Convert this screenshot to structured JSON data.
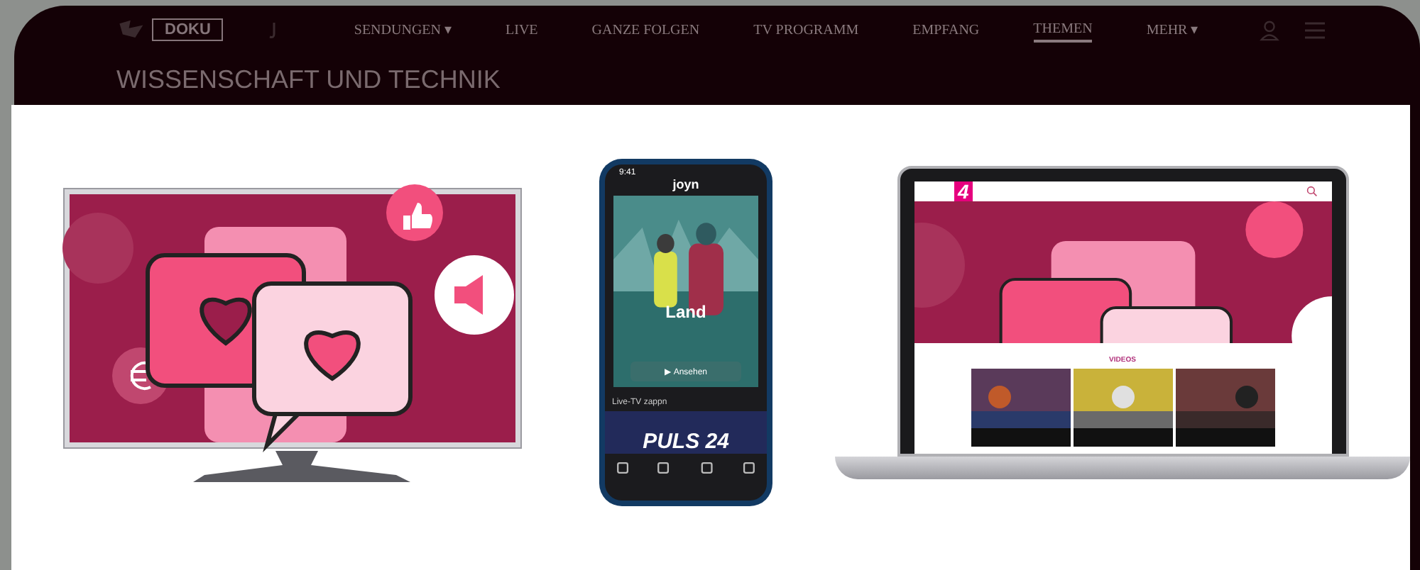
{
  "header": {
    "logo": "DOKU",
    "nav": [
      {
        "label": "SENDUNGEN ▾",
        "selected": false
      },
      {
        "label": "LIVE",
        "selected": false
      },
      {
        "label": "GANZE FOLGEN",
        "selected": false
      },
      {
        "label": "TV PROGRAMM",
        "selected": false
      },
      {
        "label": "EMPFANG",
        "selected": false
      },
      {
        "label": "THEMEN",
        "selected": true
      },
      {
        "label": "MEHR ▾",
        "selected": false
      }
    ],
    "title": "WISSENSCHAFT UND TECHNIK"
  },
  "phone": {
    "time": "9:41",
    "app": "joyn",
    "show_title": "Land",
    "button": "▶ Ansehen",
    "section": "Live-TV zappn",
    "channel": "PULS 24"
  },
  "laptop": {
    "logo": "4",
    "section": "VIDEOS"
  }
}
